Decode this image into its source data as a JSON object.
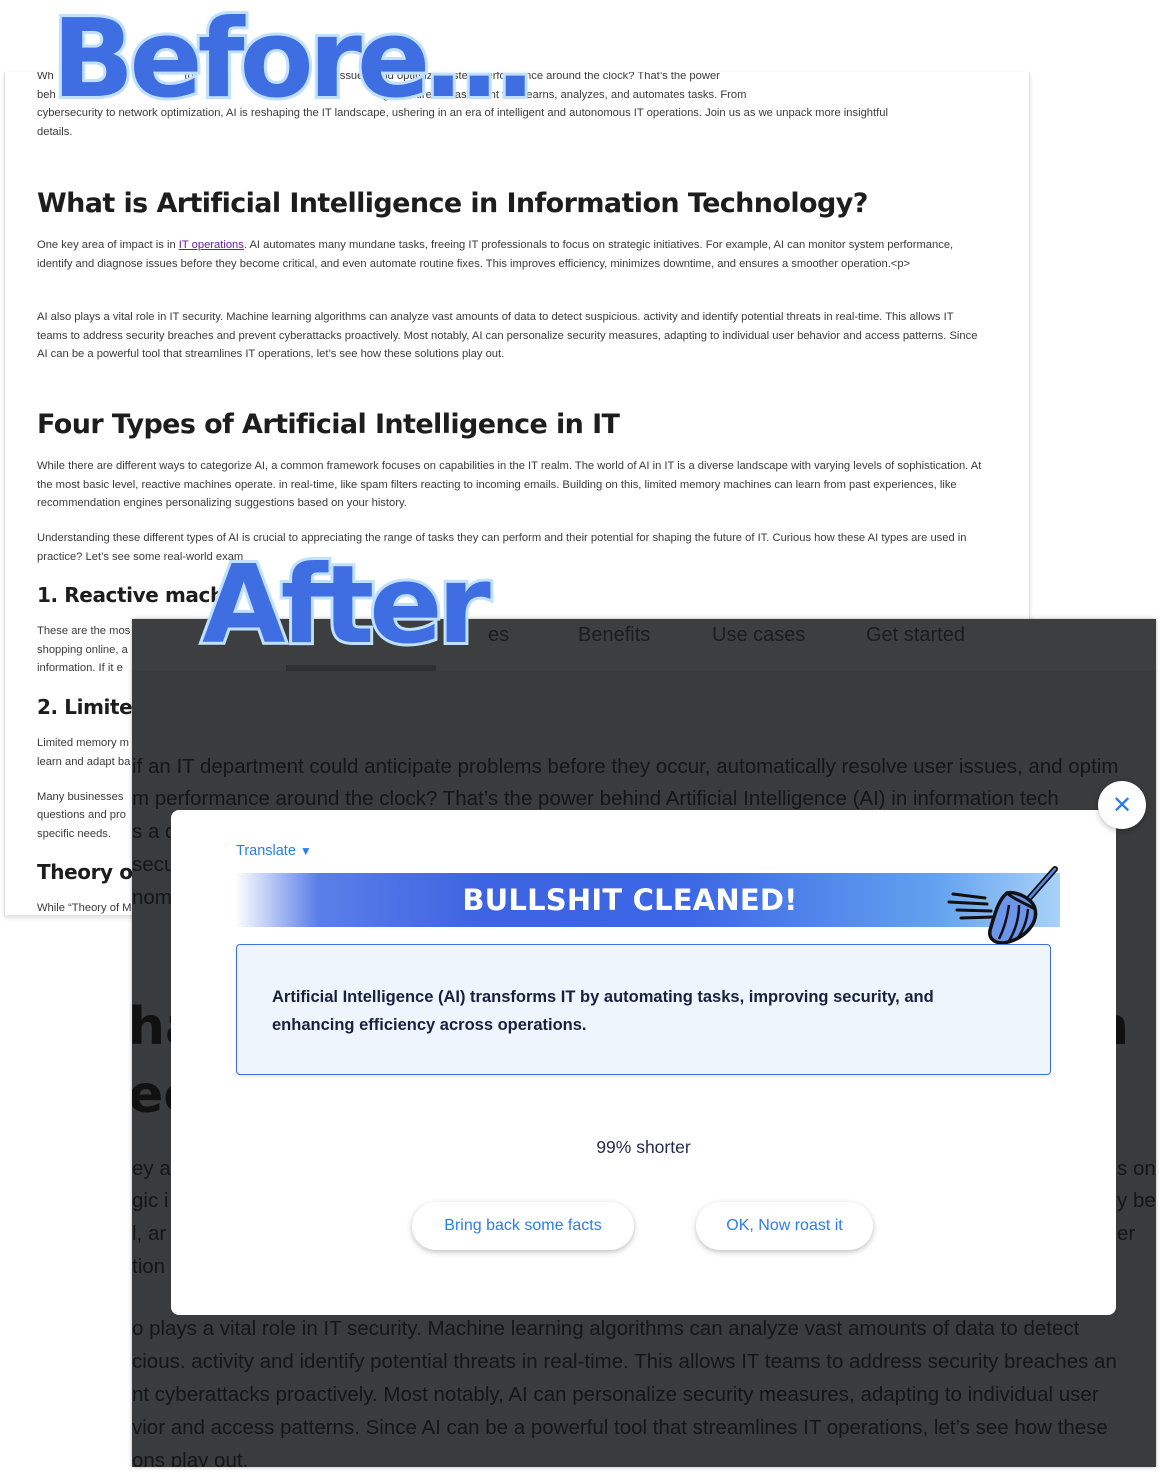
{
  "labels": {
    "before": "Before…",
    "after": "After"
  },
  "before_page": {
    "intro_lines": [
      "Wh                                          th                                          er issues, and optimize system performance around the clock? That’s the power",
      "beh                                                                   AI                                   g as a tireless assistant that learns, analyzes, and automates tasks. From",
      "cybersecurity to network optimization, AI is reshaping the IT landscape, ushering in an era of intelligent and autonomous IT operations. Join us as we unpack more insightful",
      "details."
    ],
    "h2_what": "What is Artificial Intelligence in Information Technology?",
    "p1_before_link": "One key area of impact is in ",
    "p1_link": "IT operations",
    "p1_after_link": ". AI automates many mundane tasks, freeing IT professionals to focus on strategic initiatives. For example, AI can monitor system performance, identify and diagnose issues before they become critical, and even automate routine fixes. This improves efficiency, minimizes downtime, and ensures a smoother operation.<p>",
    "p2": "AI also plays a vital role in IT security. Machine learning algorithms can analyze vast amounts of data to detect suspicious. activity and identify potential threats in real-time. This allows IT teams to address security breaches and prevent cyberattacks proactively. Most notably, AI can personalize security measures, adapting to individual user behavior and access patterns. Since AI can be a powerful tool that streamlines IT operations, let’s see how these solutions play out.",
    "h2_four": "Four Types of Artificial Intelligence in IT",
    "p3": "While there are different ways to categorize AI, a common framework focuses on capabilities in the IT realm. The world of AI in IT is a diverse landscape with varying levels of sophistication. At the most basic level, reactive machines operate. in real-time, like spam filters reacting to incoming emails. Building on this, limited memory machines can learn from past experiences, like recommendation engines personalizing suggestions based on your history.",
    "p4": "Understanding these different types of AI is crucial to appreciating the range of tasks they can perform and their potential for shaping the future of IT. Curious how these AI types are used in practice? Let’s see some real-world exam",
    "h3_reactive": "1. Reactive machi",
    "p5_lines": [
      "These are the mos",
      "shopping online, a",
      "information. If it e"
    ],
    "h3_limited": "2. Limited",
    "p6_lines": [
      "Limited memory m",
      "learn and adapt ba"
    ],
    "p7_lines": [
      "Many businesses",
      "questions and pro",
      "specific needs."
    ],
    "h3_theory": "Theory of",
    "p8": "While “Theory of M"
  },
  "after_page": {
    "nav": [
      "es",
      "Benefits",
      "Use cases",
      "Get started"
    ],
    "lines_top": [
      "if an IT department could anticipate problems before they occur, automatically resolve user issues, and optim",
      "m performance around the clock? That’s the power behind Artificial Intelligence (AI) in information tech",
      "s a d",
      "secu",
      "nomo"
    ],
    "heading_fragments": [
      "ha",
      "ec",
      "n"
    ],
    "left_fragments": [
      "ey a",
      "gic i",
      "l, ar",
      "tion"
    ],
    "right_fragments": [
      "s on",
      "y bee",
      "er"
    ],
    "lines_bottom": [
      "o plays a vital role in IT security. Machine learning algorithms can analyze vast amounts of data to detect",
      "cious. activity and identify potential threats in real-time. This allows IT teams to address security breaches an",
      "nt cyberattacks proactively. Most notably, AI can personalize security measures, adapting to individual user",
      "vior and access patterns. Since AI can be a powerful tool that streamlines IT operations, let’s see how these",
      "ons play out."
    ]
  },
  "modal": {
    "close_symbol": "✕",
    "translate_label": "Translate",
    "translate_caret": "▼",
    "banner_title": "BULLSHIT CLEANED!",
    "summary": "Artificial Intelligence (AI) transforms IT by automating tasks, improving security, and enhancing efficiency across operations.",
    "shorter_text": "99% shorter",
    "facts_button": "Bring back some facts",
    "roast_button": "OK, Now roast it"
  },
  "colors": {
    "accent": "#2b7de9",
    "label_fill": "#3f6ee3",
    "label_outline": "#bfe0ff",
    "banner_blue": "#3d63e2",
    "overlay": "#3a3b3c"
  }
}
